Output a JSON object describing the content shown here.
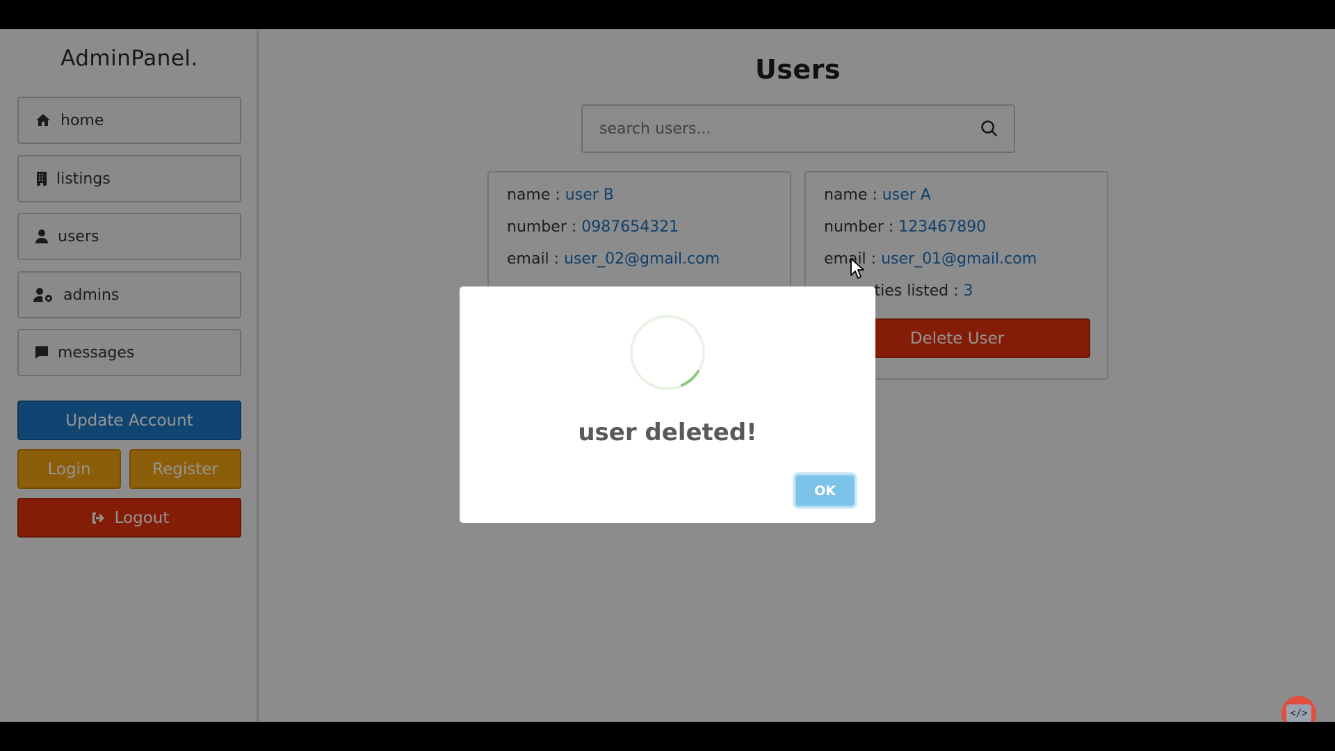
{
  "app": {
    "logo": "AdminPanel."
  },
  "sidebar": {
    "items": [
      {
        "label": "home",
        "icon": "home-icon"
      },
      {
        "label": "listings",
        "icon": "building-icon"
      },
      {
        "label": "users",
        "icon": "user-icon"
      },
      {
        "label": "admins",
        "icon": "user-gear-icon"
      },
      {
        "label": "messages",
        "icon": "comment-icon"
      }
    ],
    "update_label": "Update Account",
    "login_label": "Login",
    "register_label": "Register",
    "logout_label": "Logout"
  },
  "main": {
    "title": "Users",
    "search": {
      "placeholder": "search users..."
    },
    "cards": [
      {
        "name_label": "name : ",
        "name": "user B",
        "number_label": "number : ",
        "number": "0987654321",
        "email_label": "email : ",
        "email": "user_02@gmail.com"
      },
      {
        "name_label": "name : ",
        "name": "user A",
        "number_label": "number : ",
        "number": "123467890",
        "email_label": "email : ",
        "email": "user_01@gmail.com",
        "properties_label": "properties listed : ",
        "properties": "3",
        "delete_label": "Delete User"
      }
    ]
  },
  "modal": {
    "message": "user deleted!",
    "ok_label": "OK"
  },
  "dev_badge": {
    "label": "</>"
  },
  "colors": {
    "primary_blue": "#1d78c4",
    "warning_orange": "#f3a312",
    "danger_red": "#e3330d",
    "link_blue": "#1d6fba",
    "ok_button": "#7cc3e9"
  }
}
